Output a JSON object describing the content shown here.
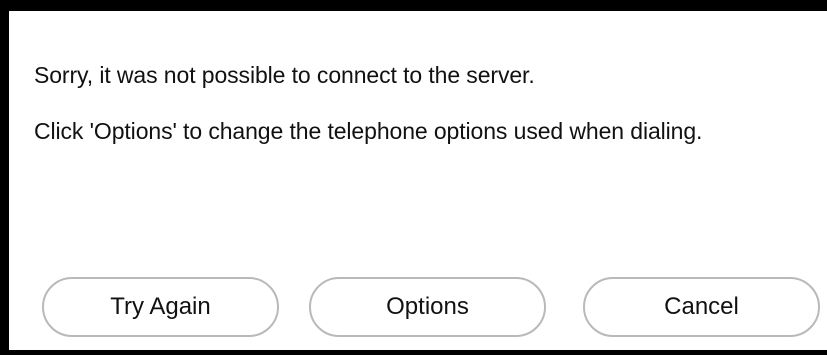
{
  "dialog": {
    "message_line1": "Sorry, it was not possible to connect to the server.",
    "message_line2": "Click 'Options' to change the telephone options used when dialing."
  },
  "buttons": {
    "try_again_label": "Try Again",
    "options_label": "Options",
    "cancel_label": "Cancel"
  },
  "colors": {
    "background": "#ffffff",
    "frame": "#000000",
    "button_border": "#b9b9b9",
    "text": "#111111"
  }
}
